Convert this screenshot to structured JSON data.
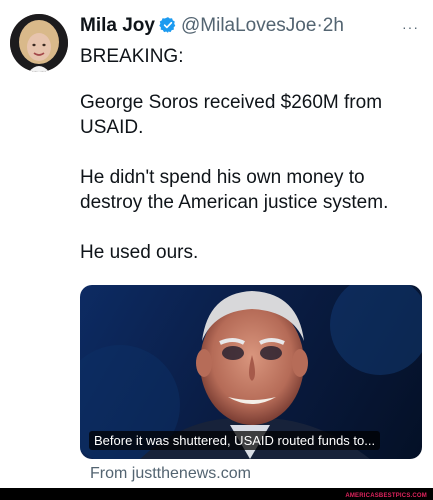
{
  "author": {
    "name": "Mila Joy",
    "handle": "@MilaLovesJoe",
    "separator": "·",
    "time": "2h"
  },
  "more_label": "···",
  "tweet": {
    "lines": [
      "BREAKING:",
      "George Soros received $260M from USAID.",
      "He didn't spend his own money to destroy the American justice system.",
      "He used ours."
    ]
  },
  "media": {
    "caption": "Before it was shuttered, USAID routed funds to..."
  },
  "source": "From justthenews.com",
  "watermark": "AMERICASBESTPICS.COM",
  "colors": {
    "verified": "#1d9bf0",
    "text": "#0f1419",
    "muted": "#536471"
  }
}
